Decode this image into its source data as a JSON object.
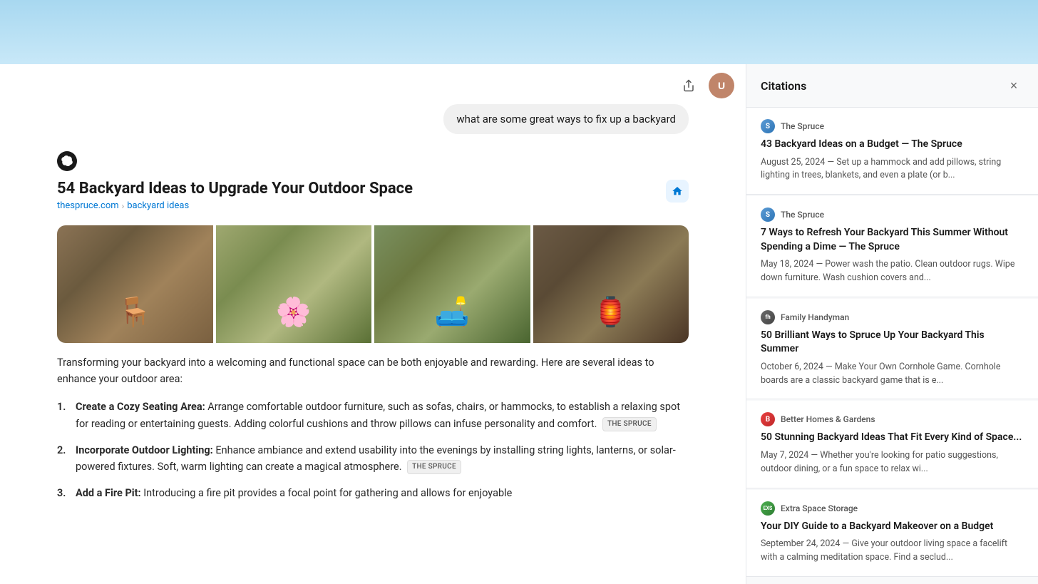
{
  "topBar": {},
  "chatHeader": {
    "shareLabel": "Share",
    "avatarInitial": "U"
  },
  "userMessage": {
    "text": "what are some great ways to fix up a backyard"
  },
  "response": {
    "title": "54 Backyard Ideas to Upgrade Your Outdoor Space",
    "breadcrumb": {
      "domain": "thespruce.com",
      "separator": "›",
      "current": "backyard ideas"
    },
    "intro": "Transforming your backyard into a welcoming and functional space can be both enjoyable and rewarding. Here are several ideas to enhance your outdoor area:",
    "listItems": [
      {
        "num": "1.",
        "label": "Create a Cozy Seating Area:",
        "text": "Arrange comfortable outdoor furniture, such as sofas, chairs, or hammocks, to establish a relaxing spot for reading or entertaining guests. Adding colorful cushions and throw pillows can infuse personality and comfort.",
        "citation": "THE SPRUCE"
      },
      {
        "num": "2.",
        "label": "Incorporate Outdoor Lighting:",
        "text": "Enhance ambiance and extend usability into the evenings by installing string lights, lanterns, or solar-powered fixtures. Soft, warm lighting can create a magical atmosphere.",
        "citation": "THE SPRUCE"
      },
      {
        "num": "3.",
        "label": "Add a Fire Pit:",
        "text": "Introducing a fire pit provides a focal point for gathering and allows for enjoyable",
        "citation": null
      }
    ]
  },
  "citations": {
    "panelTitle": "Citations",
    "closeButton": "×",
    "items": [
      {
        "source": "The Spruce",
        "faviconType": "spruce",
        "faviconLetter": "S",
        "title": "43 Backyard Ideas on a Budget — The Spruce",
        "snippet": "August 25, 2024 — Set up a hammock and add pillows, string lighting in trees, blankets, and even a plate (or b..."
      },
      {
        "source": "The Spruce",
        "faviconType": "spruce",
        "faviconLetter": "S",
        "title": "7 Ways to Refresh Your Backyard This Summer Without Spending a Dime — The Spruce",
        "snippet": "May 18, 2024 — Power wash the patio. Clean outdoor rugs. Wipe down furniture. Wash cushion covers and..."
      },
      {
        "source": "Family Handyman",
        "faviconType": "fh",
        "faviconLetter": "fh",
        "title": "50 Brilliant Ways to Spruce Up Your Backyard This Summer",
        "snippet": "October 6, 2024 — Make Your Own Cornhole Game. Cornhole boards are a classic backyard game that is e..."
      },
      {
        "source": "Better Homes & Gardens",
        "faviconType": "bhg",
        "faviconLetter": "B",
        "title": "50 Stunning Backyard Ideas That Fit Every Kind of Space...",
        "snippet": "May 7, 2024 — Whether you're looking for patio suggestions, outdoor dining, or a fun space to relax wi..."
      },
      {
        "source": "Extra Space Storage",
        "faviconType": "ess",
        "faviconLetter": "EXS",
        "title": "Your DIY Guide to a Backyard Makeover on a Budget",
        "snippet": "September 24, 2024 — Give your outdoor living space a facelift with a calming meditation space. Find a seclud..."
      }
    ]
  }
}
